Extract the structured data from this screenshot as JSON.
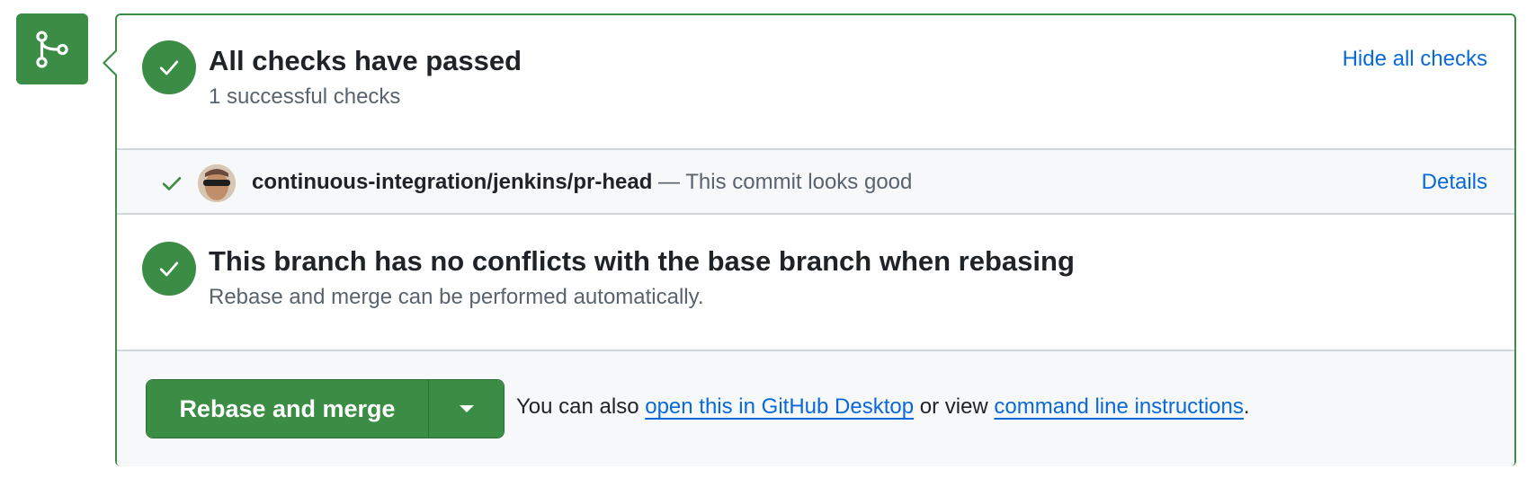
{
  "checks": {
    "title": "All checks have passed",
    "subtitle": "1 successful checks",
    "toggle_label": "Hide all checks"
  },
  "check_items": [
    {
      "name": "continuous-integration/jenkins/pr-head",
      "description": " — This commit looks good",
      "details_label": "Details"
    }
  ],
  "conflicts": {
    "title": "This branch has no conflicts with the base branch when rebasing",
    "subtitle": "Rebase and merge can be performed automatically."
  },
  "merge": {
    "button_label": "Rebase and merge",
    "hint_prefix": "You can also ",
    "desktop_link": "open this in GitHub Desktop",
    "hint_middle": " or view ",
    "cli_link": "command line instructions",
    "hint_suffix": "."
  },
  "colors": {
    "success": "#3b8c45",
    "link": "#0969da",
    "muted": "#59636e"
  },
  "icons": {
    "badge": "git-merge-icon",
    "status": "check-icon",
    "dropdown": "triangle-down-icon"
  }
}
